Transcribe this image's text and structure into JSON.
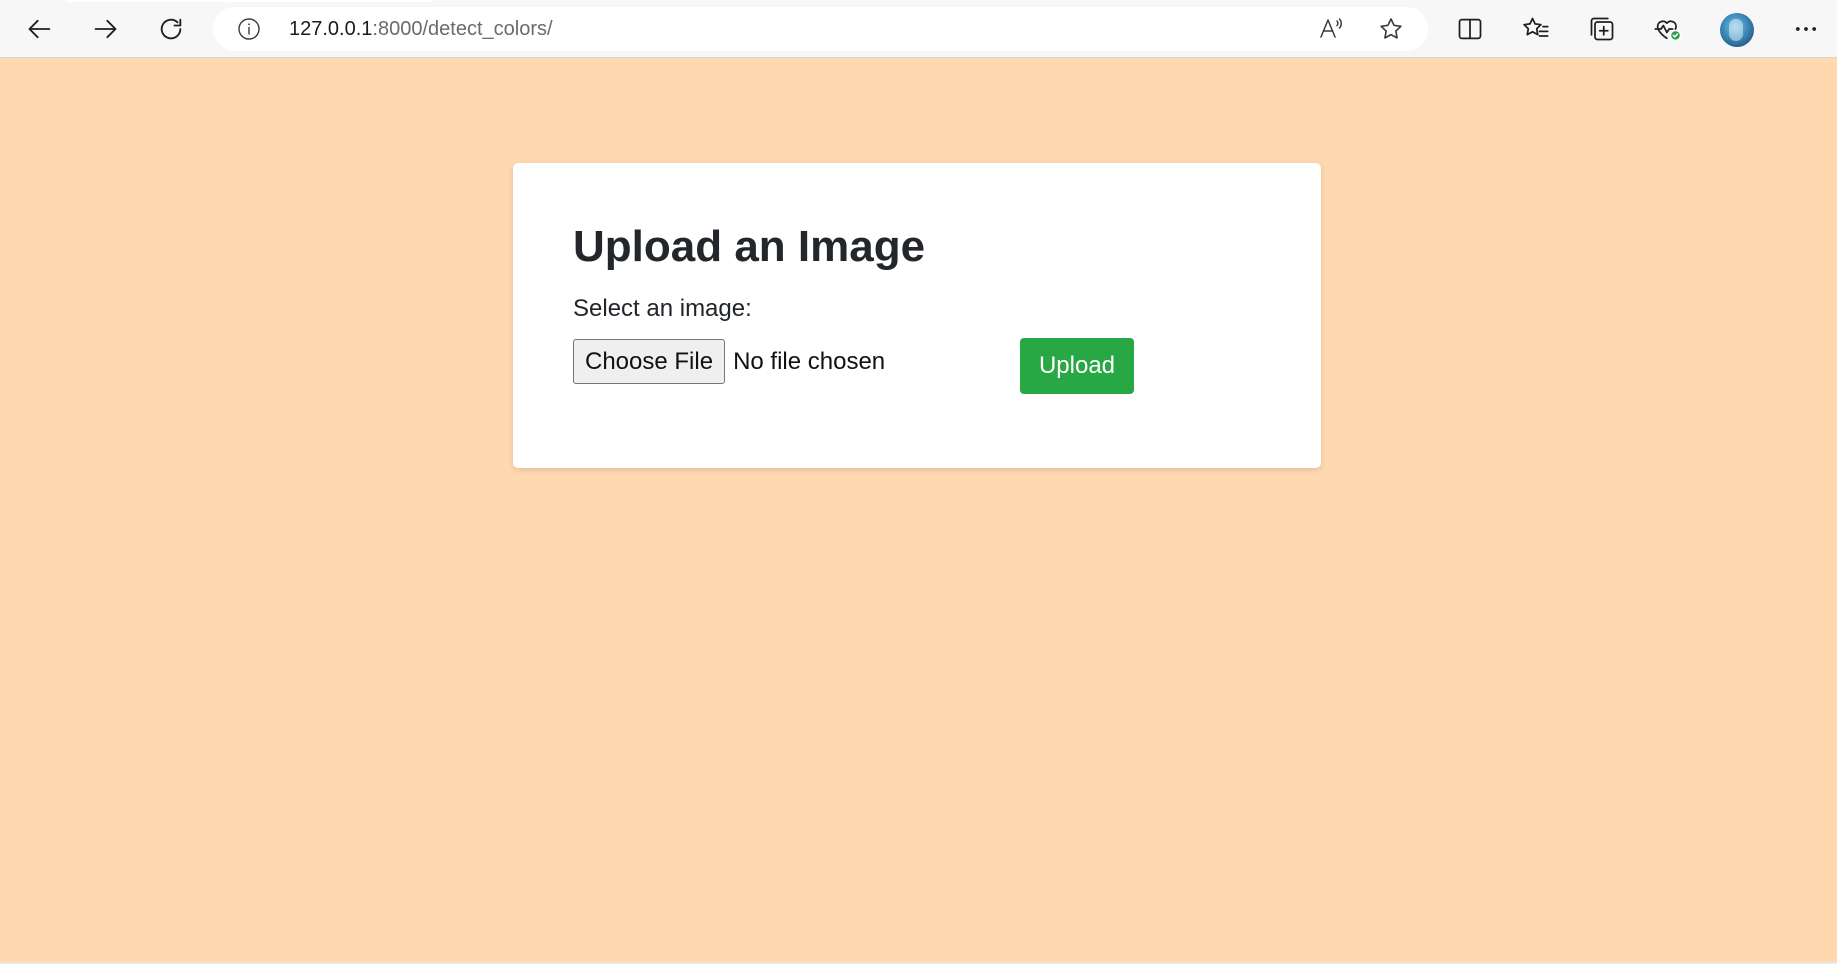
{
  "browser": {
    "url_host": "127.0.0.1",
    "url_path": ":8000/detect_colors/",
    "icons": {
      "back": "back-arrow-icon",
      "forward": "forward-arrow-icon",
      "refresh": "refresh-icon",
      "site_info": "info-icon",
      "read_aloud": "read-aloud-icon",
      "favorite": "star-icon",
      "split_screen": "split-screen-icon",
      "favorites": "favorites-icon",
      "collections": "collections-icon",
      "performance": "heart-pulse-icon",
      "more": "more-icon"
    }
  },
  "page": {
    "background": "#ffd8b0",
    "title": "Upload an Image",
    "field_label": "Select an image:",
    "choose_file_label": "Choose File",
    "file_status": "No file chosen",
    "upload_label": "Upload",
    "upload_color": "#28a745"
  }
}
